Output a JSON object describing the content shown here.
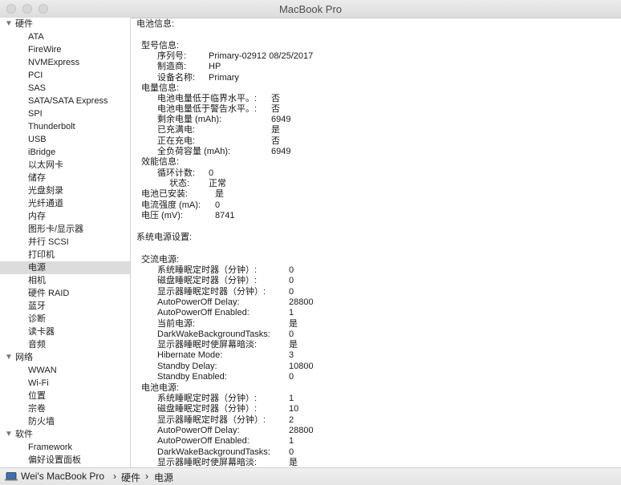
{
  "window": {
    "title": "MacBook Pro"
  },
  "sidebar": {
    "groups": [
      {
        "label": "硬件",
        "items": [
          "ATA",
          "FireWire",
          "NVMExpress",
          "PCI",
          "SAS",
          "SATA/SATA Express",
          "SPI",
          "Thunderbolt",
          "USB",
          "iBridge",
          "以太网卡",
          "储存",
          "光盘刻录",
          "光纤通道",
          "内存",
          "图形卡/显示器",
          "并行 SCSI",
          "打印机",
          "电源",
          "相机",
          "硬件 RAID",
          "蓝牙",
          "诊断",
          "读卡器",
          "音频"
        ]
      },
      {
        "label": "网络",
        "items": [
          "WWAN",
          "Wi-Fi",
          "位置",
          "宗卷",
          "防火墙"
        ]
      },
      {
        "label": "软件",
        "items": [
          "Framework",
          "偏好设置面板"
        ]
      }
    ],
    "selected": "电源"
  },
  "content": {
    "battery_header": "电池信息:",
    "model_header": "型号信息:",
    "serial_label": "序列号:",
    "serial_value": "Primary-02912 08/25/2017",
    "maker_label": "制造商:",
    "maker_value": "HP",
    "device_label": "设备名称:",
    "device_value": "Primary",
    "charge_header": "电量信息:",
    "below_critical_label": "电池电量低于临界水平。:",
    "below_critical_value": "否",
    "below_warning_label": "电池电量低于警告水平。:",
    "below_warning_value": "否",
    "remaining_label": "剩余电量 (mAh):",
    "remaining_value": "6949",
    "full_label": "已充满电:",
    "full_value": "是",
    "charging_label": "正在充电:",
    "charging_value": "否",
    "full_capacity_label": "全负荷容量 (mAh):",
    "full_capacity_value": "6949",
    "health_header": "效能信息:",
    "cycle_label": "循环计数:",
    "cycle_value": "0",
    "condition_label": "状态:",
    "condition_value": "正常",
    "installed_label": "电池已安装:",
    "installed_value": "是",
    "amperage_label": "电流强度 (mA):",
    "amperage_value": "0",
    "voltage_label": "电压 (mV):",
    "voltage_value": "8741",
    "power_settings_header": "系统电源设置:",
    "ac_header": "交流电源:",
    "ac_rows": [
      [
        "系统睡眠定时器（分钟）:",
        "0"
      ],
      [
        "磁盘睡眠定时器（分钟）:",
        "0"
      ],
      [
        "显示器睡眠定时器（分钟）:",
        "0"
      ],
      [
        "AutoPowerOff Delay:",
        "28800"
      ],
      [
        "AutoPowerOff Enabled:",
        "1"
      ],
      [
        "当前电源:",
        "是"
      ],
      [
        "DarkWakeBackgroundTasks:",
        "0"
      ],
      [
        "显示器睡眠时使屏幕暗淡:",
        "是"
      ],
      [
        "Hibernate Mode:",
        "3"
      ],
      [
        "Standby Delay:",
        "10800"
      ],
      [
        "Standby Enabled:",
        "0"
      ]
    ],
    "battery_power_header": "电池电源:",
    "bat_rows": [
      [
        "系统睡眠定时器（分钟）:",
        "1"
      ],
      [
        "磁盘睡眠定时器（分钟）:",
        "10"
      ],
      [
        "显示器睡眠定时器（分钟）:",
        "2"
      ],
      [
        "AutoPowerOff Delay:",
        "28800"
      ],
      [
        "AutoPowerOff Enabled:",
        "1"
      ],
      [
        "DarkWakeBackgroundTasks:",
        "0"
      ],
      [
        "显示器睡眠时使屏幕暗淡:",
        "是"
      ]
    ]
  },
  "statusbar": {
    "computer": "Wei's MacBook Pro",
    "sep1": "›",
    "crumb1": "硬件",
    "sep2": "›",
    "crumb2": "电源"
  }
}
